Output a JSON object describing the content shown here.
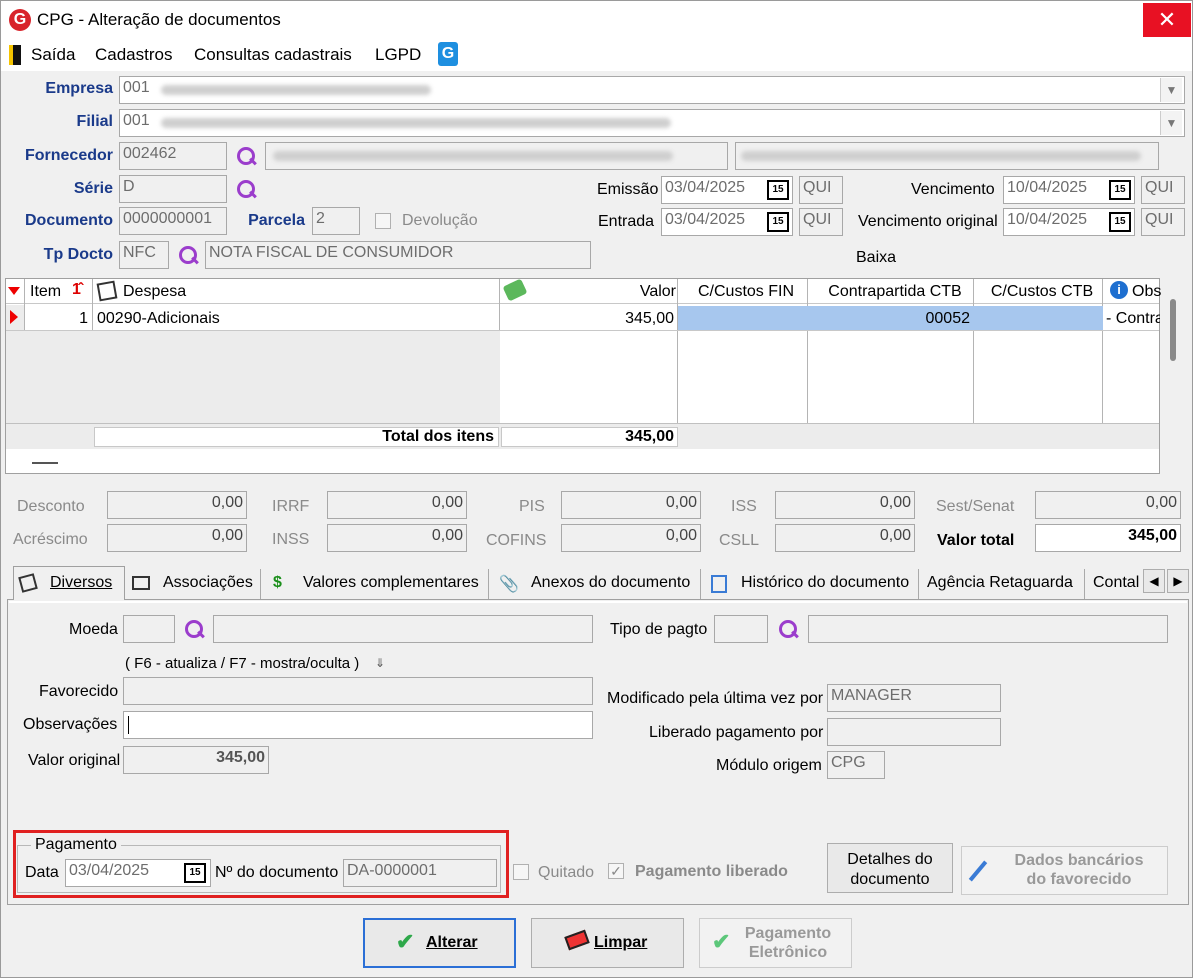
{
  "window": {
    "title": "CPG - Alteração de documentos"
  },
  "menu": [
    "Saída",
    "Cadastros",
    "Consultas cadastrais",
    "LGPD"
  ],
  "header": {
    "empresa_label": "Empresa",
    "empresa_code": "001",
    "filial_label": "Filial",
    "filial_code": "001",
    "fornecedor_label": "Fornecedor",
    "fornecedor_code": "002462",
    "serie_label": "Série",
    "serie_value": "D",
    "documento_label": "Documento",
    "documento_value": "0000000001",
    "parcela_label": "Parcela",
    "parcela_value": "2",
    "devolucao_label": "Devolução",
    "tpdocto_label": "Tp Docto",
    "tpdocto_code": "NFC",
    "tpdocto_desc": "NOTA FISCAL DE CONSUMIDOR",
    "emissao_label": "Emissão",
    "emissao_value": "03/04/2025",
    "emissao_day": "QUI",
    "entrada_label": "Entrada",
    "entrada_value": "03/04/2025",
    "entrada_day": "QUI",
    "vencimento_label": "Vencimento",
    "vencimento_value": "10/04/2025",
    "vencimento_day": "QUI",
    "venc_original_label": "Vencimento original",
    "venc_original_value": "10/04/2025",
    "venc_original_day": "QUI",
    "baixa_label": "Baixa",
    "cal_icon_text": "15"
  },
  "grid": {
    "headers": {
      "item": "Item",
      "despesa": "Despesa",
      "valor": "Valor",
      "cc_fin": "C/Custos FIN",
      "contrapartida": "Contrapartida CTB",
      "cc_ctb": "C/Custos CTB",
      "obs": "Obs"
    },
    "rows": [
      {
        "item": "1",
        "despesa": "00290-Adicionais",
        "valor": "345,00",
        "cc_fin": "",
        "contrapartida": "00052",
        "cc_ctb": "",
        "obs": "- Contra"
      }
    ],
    "total_label": "Total dos itens",
    "total_value": "345,00"
  },
  "totals": {
    "desconto_label": "Desconto",
    "desconto": "0,00",
    "acrescimo_label": "Acréscimo",
    "acrescimo": "0,00",
    "irrf_label": "IRRF",
    "irrf": "0,00",
    "inss_label": "INSS",
    "inss": "0,00",
    "pis_label": "PIS",
    "pis": "0,00",
    "cofins_label": "COFINS",
    "cofins": "0,00",
    "iss_label": "ISS",
    "iss": "0,00",
    "csll_label": "CSLL",
    "csll": "0,00",
    "sest_label": "Sest/Senat",
    "sest": "0,00",
    "valor_total_label": "Valor total",
    "valor_total": "345,00"
  },
  "tabs": [
    "Diversos",
    "Associações",
    "Valores complementares",
    "Anexos do documento",
    "Histórico do documento",
    "Agência Retaguarda",
    "Contal"
  ],
  "diversos": {
    "moeda_label": "Moeda",
    "tipo_pagto_label": "Tipo de pagto",
    "hint": "( F6 - atualiza / F7 - mostra/oculta )",
    "favorecido_label": "Favorecido",
    "observacoes_label": "Observações",
    "valor_original_label": "Valor original",
    "valor_original": "345,00",
    "modificado_label": "Modificado pela última vez por",
    "modificado_value": "MANAGER",
    "liberado_label": "Liberado pagamento por",
    "liberado_value": "",
    "modulo_label": "Módulo origem",
    "modulo_value": "CPG"
  },
  "pagamento": {
    "group_label": "Pagamento",
    "data_label": "Data",
    "data_value": "03/04/2025",
    "ndoc_label": "Nº do documento",
    "ndoc_value": "DA-0000001",
    "quitado_label": "Quitado",
    "liberado_label": "Pagamento liberado"
  },
  "buttons": {
    "detalhes": "Detalhes do documento",
    "dados_bancarios": "Dados bancários do favorecido",
    "alterar": "Alterar",
    "limpar": "Limpar",
    "pagamento_eletronico": "Pagamento Eletrônico"
  },
  "colors": {
    "accent_blue": "#1a3a8a",
    "highlight": "#a7c7ee",
    "close_red": "#e81123",
    "red_frame": "#e02020"
  }
}
